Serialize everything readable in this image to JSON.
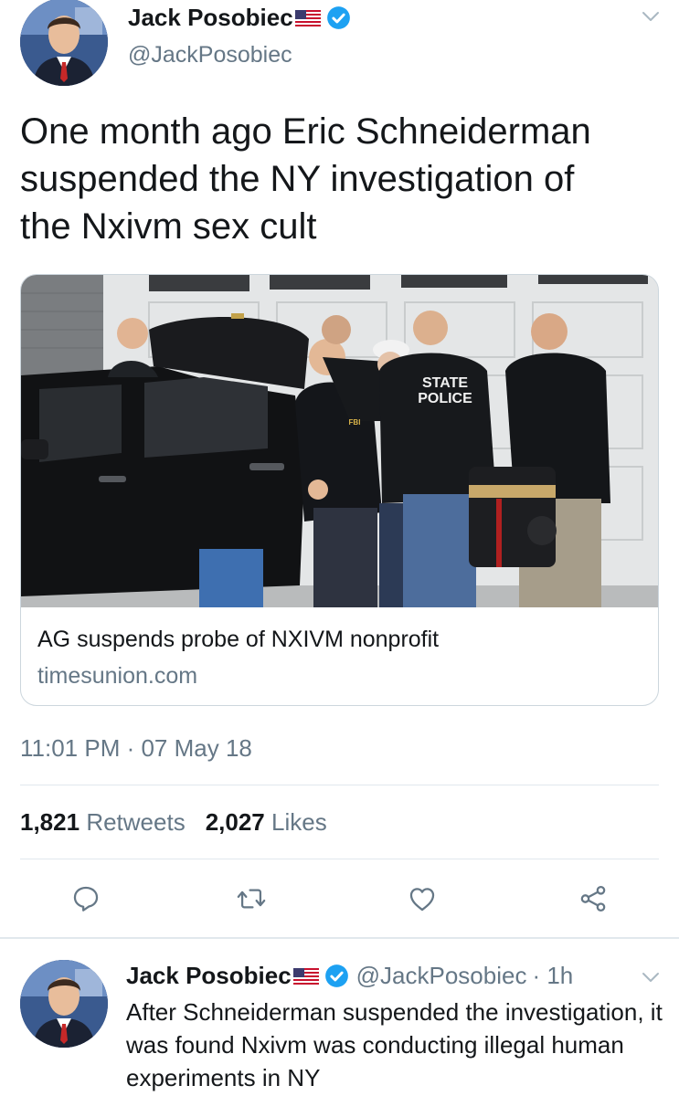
{
  "tweet": {
    "author": {
      "display_name": "Jack Posobiec",
      "handle": "@JackPosobiec",
      "verified": true,
      "flag": "us-flag-emoji"
    },
    "text_lines": [
      "One month ago Eric Schneiderman",
      "suspended the NY investigation of",
      "the Nxivm sex cult"
    ],
    "card": {
      "title": "AG suspends probe of NXIVM nonprofit",
      "domain": "timesunion.com",
      "image_text": {
        "vest_line1": "STATE",
        "vest_line2": "POLICE",
        "jacket": "FBI"
      }
    },
    "timestamp": "11:01 PM · 07 May 18",
    "stats": {
      "retweets_count": "1,821",
      "retweets_label": "Retweets",
      "likes_count": "2,027",
      "likes_label": "Likes"
    },
    "actions": [
      "reply-icon",
      "retweet-icon",
      "like-icon",
      "share-icon"
    ]
  },
  "reply": {
    "author": {
      "display_name": "Jack Posobiec",
      "handle": "@JackPosobiec",
      "time": "· 1h",
      "verified": true,
      "flag": "us-flag-emoji"
    },
    "text": "After Schneiderman suspended the investigation, it was found Nxivm was conducting illegal human experiments in NY"
  },
  "colors": {
    "verified_blue": "#1da1f2",
    "muted": "#657786",
    "text": "#14171a",
    "divider": "#e1e8ed"
  }
}
